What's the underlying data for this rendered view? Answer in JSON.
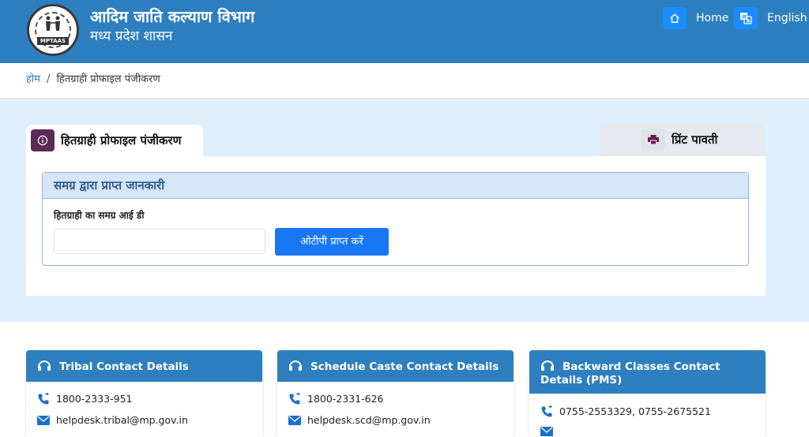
{
  "header": {
    "logo_text": "MPTAAS",
    "title": "आदिम जाति कल्याण विभाग",
    "subtitle": "मध्य प्रदेश शासन",
    "home_label": "Home",
    "lang_label": "English"
  },
  "breadcrumb": {
    "home": "होम",
    "separator": "/",
    "current": "हितग्राही प्रोफाइल पंजीकरण"
  },
  "tabs": {
    "active_label": "हितग्राही प्रोफाइल पंजीकरण",
    "print_label": "प्रिंट पावती"
  },
  "form": {
    "section_title": "समग्र द्वारा प्राप्त जानकारी",
    "field_label": "हितग्राही का समग्र आई डी",
    "field_value": "",
    "otp_button": "ओटीपी प्राप्त करें"
  },
  "contacts": [
    {
      "title": "Tribal Contact Details",
      "phone": "1800-2333-951",
      "email": "helpdesk.tribal@mp.gov.in"
    },
    {
      "title": "Schedule Caste Contact Details",
      "phone": "1800-2331-626",
      "email": "helpdesk.scd@mp.gov.in"
    },
    {
      "title": "Backward Classes Contact Details (PMS)",
      "phone": "0755-2553329, 0755-2675521",
      "email": ""
    }
  ],
  "colors": {
    "header_bg": "#2e7fbf",
    "band_bg": "#deeefd",
    "primary_button": "#1877f2",
    "tab_icon_bg": "#5b2b57"
  },
  "icons": {
    "home": "home-icon",
    "translate": "translate-icon",
    "info": "info-icon",
    "print": "printer-icon",
    "headset": "headset-icon",
    "phone": "phone-icon",
    "email": "email-icon"
  }
}
